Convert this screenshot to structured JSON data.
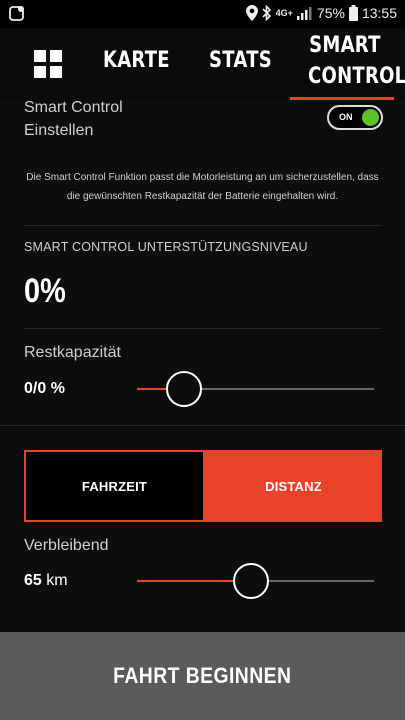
{
  "status_bar": {
    "network": "4G+",
    "battery": "75%",
    "time": "13:55"
  },
  "nav": {
    "tabs": [
      {
        "label": "KARTE",
        "active": false
      },
      {
        "label": "STATS",
        "active": false
      },
      {
        "label_line1": "SMART",
        "label_line2": "CONTROL",
        "active": true
      }
    ],
    "accent_color": "#e8432a"
  },
  "smart_control": {
    "title_line1": "Smart Control",
    "title_line2": "Einstellen",
    "toggle_label": "ON",
    "toggle_on": true,
    "description": "Die Smart Control Funktion passt die Motorleistung an um sicherzustellen, dass die gewünschten Restkapazität der Batterie eingehalten wird."
  },
  "support_level": {
    "title": "SMART CONTROL UNTERSTÜTZUNGSNIVEAU",
    "value": "0%"
  },
  "rest_capacity": {
    "label": "Restkapazität",
    "value": "0/0 %",
    "slider_fraction": 0.2
  },
  "mode": {
    "options": [
      "FAHRZEIT",
      "DISTANZ"
    ],
    "selected": "DISTANZ"
  },
  "remaining": {
    "label": "Verbleibend",
    "value": "65",
    "unit": "km",
    "slider_fraction": 0.48
  },
  "start_button": {
    "label": "FAHRT BEGINNEN"
  }
}
